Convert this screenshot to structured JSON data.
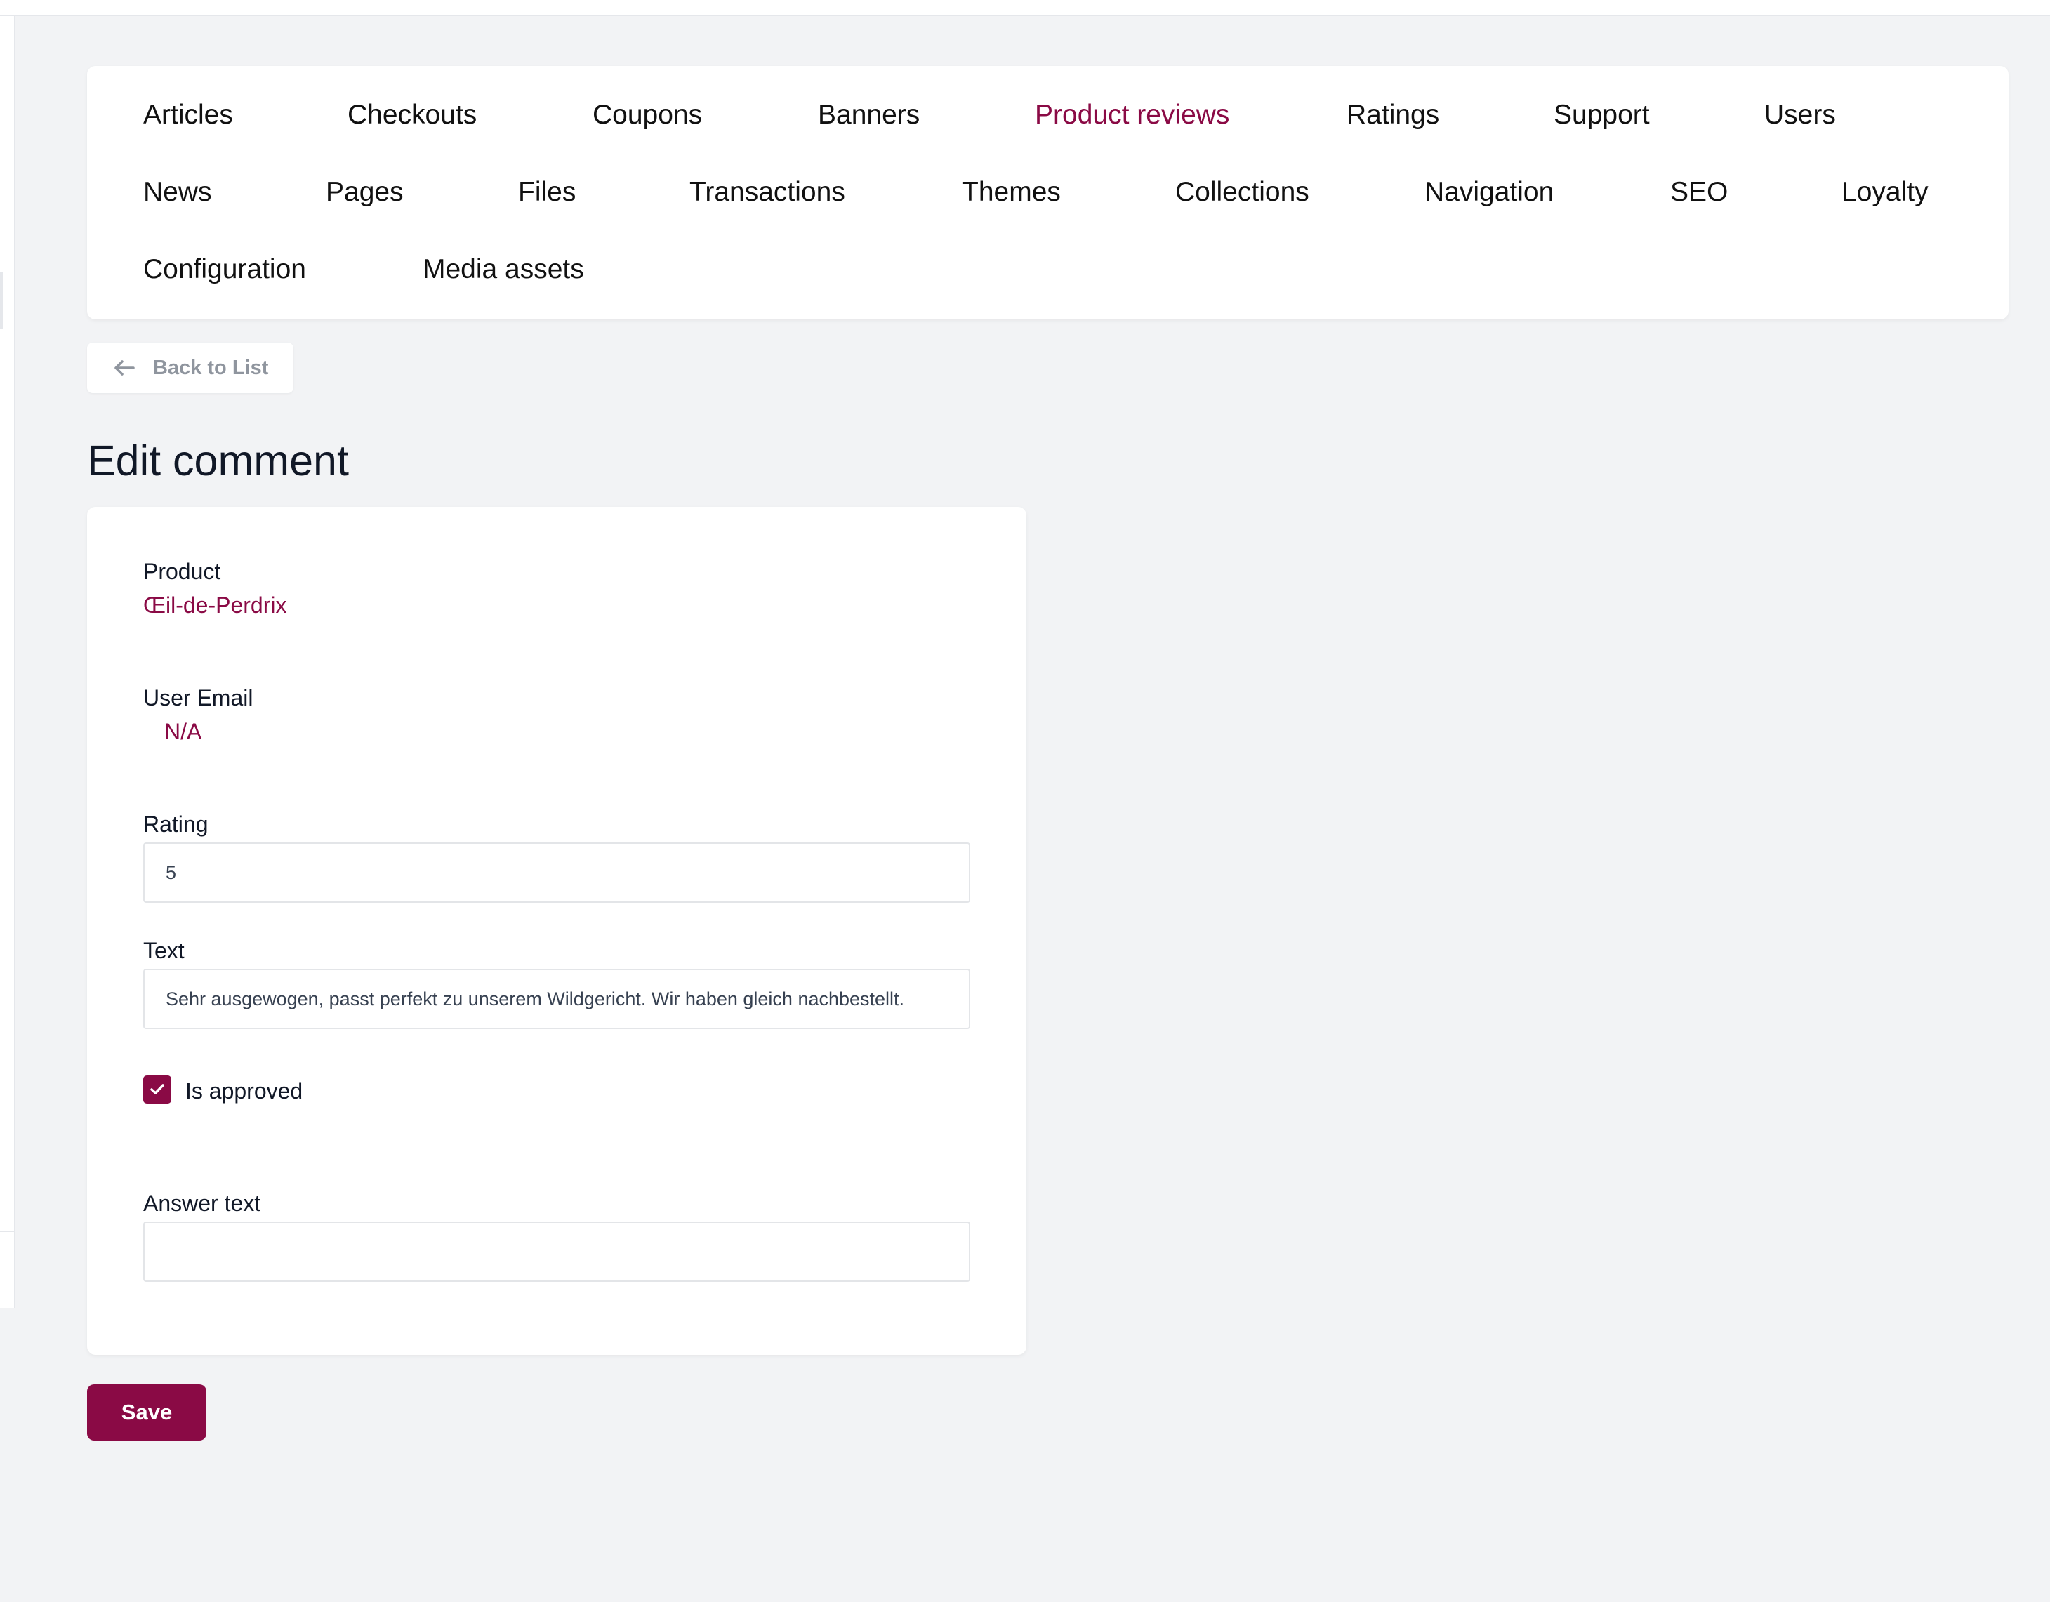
{
  "nav": {
    "items": [
      {
        "label": "Articles"
      },
      {
        "label": "Checkouts"
      },
      {
        "label": "Coupons"
      },
      {
        "label": "Banners"
      },
      {
        "label": "Product reviews",
        "active": true
      },
      {
        "label": "Ratings"
      },
      {
        "label": "Support"
      },
      {
        "label": "Users"
      },
      {
        "label": "News"
      },
      {
        "label": "Pages"
      },
      {
        "label": "Files"
      },
      {
        "label": "Transactions"
      },
      {
        "label": "Themes"
      },
      {
        "label": "Collections"
      },
      {
        "label": "Navigation"
      },
      {
        "label": "SEO"
      },
      {
        "label": "Loyalty"
      },
      {
        "label": "Configuration"
      },
      {
        "label": "Media assets"
      }
    ]
  },
  "back_button": {
    "label": "Back to List",
    "icon": "arrow-left-icon"
  },
  "page_title": "Edit comment",
  "form": {
    "product": {
      "label": "Product",
      "value": "Œil-de-Perdrix"
    },
    "user_email": {
      "label": "User Email",
      "value": "N/A"
    },
    "rating": {
      "label": "Rating",
      "value": "5"
    },
    "text": {
      "label": "Text",
      "value": "Sehr ausgewogen, passt perfekt zu unserem Wildgericht. Wir haben gleich nachbestellt."
    },
    "is_approved": {
      "label": "Is approved",
      "checked": true
    },
    "answer_text": {
      "label": "Answer text",
      "value": ""
    }
  },
  "save_button": {
    "label": "Save"
  },
  "colors": {
    "accent": "#8a0a45",
    "background": "#f2f3f5",
    "card": "#ffffff"
  }
}
